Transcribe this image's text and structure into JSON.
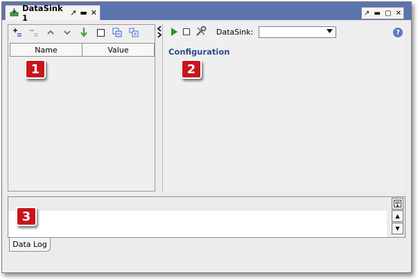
{
  "tab": {
    "title": "DataSink 1",
    "pin_glyph": "↗",
    "minimize_glyph": "▬",
    "close_glyph": "✕"
  },
  "window_ctrls": {
    "pin_glyph": "↗",
    "minimize_glyph": "▬",
    "maximize_glyph": "▢",
    "close_glyph": "✕"
  },
  "left": {
    "toolbar": [
      "add",
      "remove",
      "move-up",
      "move-down",
      "import",
      "stop",
      "copy",
      "paste"
    ],
    "columns": {
      "name": "Name",
      "value": "Value"
    }
  },
  "right": {
    "sink_label": "DataSink:",
    "sink_value": "",
    "config_label": "Configuration"
  },
  "log": {
    "tab_label": "Data Log"
  },
  "callouts": {
    "one": "1",
    "two": "2",
    "three": "3"
  },
  "colors": {
    "titlebar": "#5b74b0",
    "callout": "#c8141c",
    "config_text": "#2c4a8c",
    "play": "#1e9a2c"
  }
}
